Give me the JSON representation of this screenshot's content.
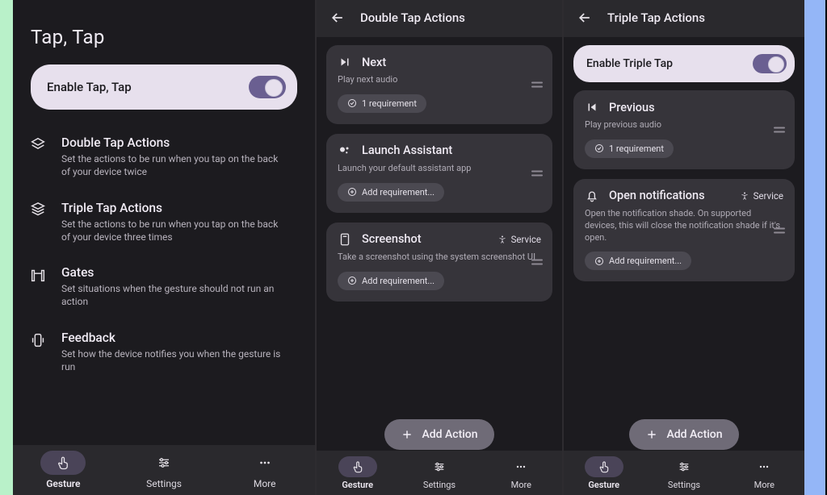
{
  "screen1": {
    "title": "Tap, Tap",
    "enable_label": "Enable Tap, Tap",
    "menu": [
      {
        "title": "Double Tap Actions",
        "sub": "Set the actions to be run when you tap on the back of your device twice"
      },
      {
        "title": "Triple Tap Actions",
        "sub": "Set the actions to be run when you tap on the back of your device three times"
      },
      {
        "title": "Gates",
        "sub": "Set situations when the gesture should not run an action"
      },
      {
        "title": "Feedback",
        "sub": "Set how the device notifies you when the gesture is run"
      }
    ]
  },
  "screen2": {
    "header": "Double Tap Actions",
    "cards": [
      {
        "title": "Next",
        "sub": "Play next audio",
        "chip": "1 requirement",
        "chip_kind": "ok"
      },
      {
        "title": "Launch Assistant",
        "sub": "Launch your default assistant app",
        "chip": "Add requirement...",
        "chip_kind": "add"
      },
      {
        "title": "Screenshot",
        "sub": "Take a screenshot using the system screenshot UI",
        "chip": "Add requirement...",
        "chip_kind": "add",
        "service": "Service"
      }
    ],
    "add_action": "Add Action"
  },
  "screen3": {
    "header": "Triple Tap Actions",
    "enable_label": "Enable Triple Tap",
    "cards": [
      {
        "title": "Previous",
        "sub": "Play previous audio",
        "chip": "1 requirement",
        "chip_kind": "ok"
      },
      {
        "title": "Open notifications",
        "sub": "Open the notification shade. On supported devices, this will close the notification shade if it's open.",
        "chip": "Add requirement...",
        "chip_kind": "add",
        "service": "Service"
      }
    ],
    "add_action": "Add Action"
  },
  "bottomnav": {
    "gesture": "Gesture",
    "settings": "Settings",
    "more": "More"
  }
}
